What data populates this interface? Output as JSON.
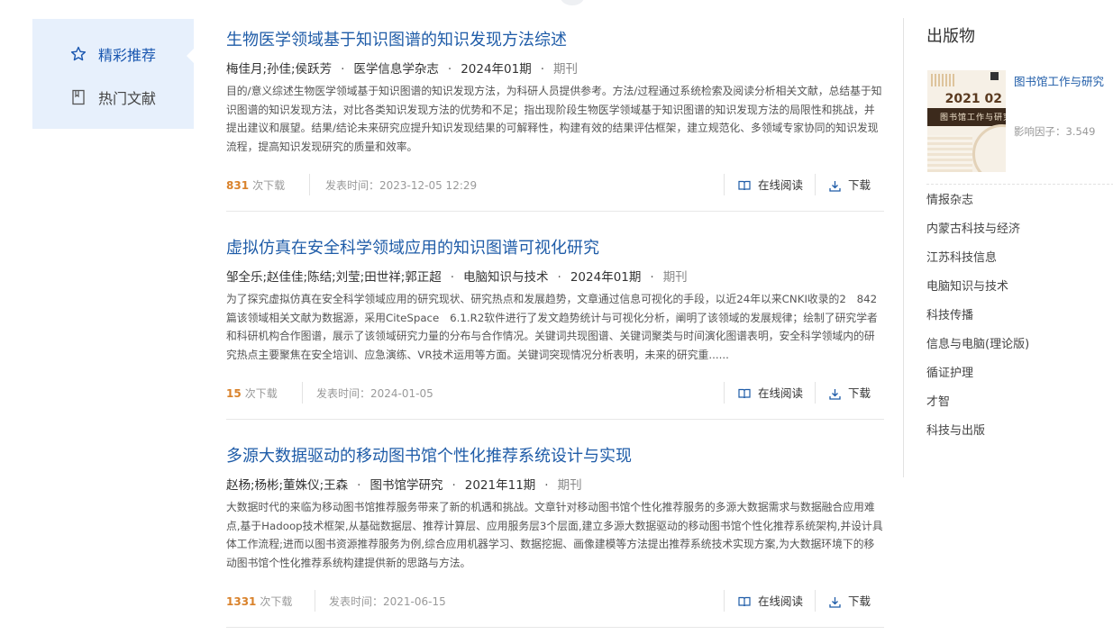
{
  "nav": {
    "items": [
      {
        "label": "精彩推荐",
        "icon": "star-icon",
        "active": true
      },
      {
        "label": "热门文献",
        "icon": "bookmark-icon",
        "active": false
      }
    ]
  },
  "articles": [
    {
      "title": "生物医学领域基于知识图谱的知识发现方法综述",
      "authors": "梅佳月;孙佳;侯跃芳",
      "journal": "医学信息学杂志",
      "issue": "2024年01期",
      "type": "期刊",
      "abstract": "目的/意义综述生物医学领域基于知识图谱的知识发现方法，为科研人员提供参考。方法/过程通过系统检索及阅读分析相关文献，总结基于知识图谱的知识发现方法，对比各类知识发现方法的优势和不足；指出现阶段生物医学领域基于知识图谱的知识发现方法的局限性和挑战，并提出建议和展望。结果/结论未来研究应提升知识发现结果的可解释性，构建有效的结果评估框架，建立规范化、多领域专家协同的知识发现流程，提高知识发现研究的质量和效率。",
      "downloads": "831",
      "downloads_unit": "次下载",
      "pub_time": "发表时间：2023-12-05 12:29",
      "read_label": "在线阅读",
      "download_label": "下载"
    },
    {
      "title": "虚拟仿真在安全科学领域应用的知识图谱可视化研究",
      "authors": "邹全乐;赵佳佳;陈结;刘莹;田世祥;郭正超",
      "journal": "电脑知识与技术",
      "issue": "2024年01期",
      "type": "期刊",
      "abstract": "为了探究虚拟仿真在安全科学领域应用的研究现状、研究热点和发展趋势，文章通过信息可视化的手段，以近24年以来CNKI收录的2　842篇该领域相关文献为数据源，采用CiteSpace　6.1.R2软件进行了发文趋势统计与可视化分析，阐明了该领域的发展规律；绘制了研究学者和科研机构合作图谱，展示了该领域研究力量的分布与合作情况。关键词共现图谱、关键词聚类与时间演化图谱表明，安全科学领域内的研究热点主要聚焦在安全培训、应急演练、VR技术运用等方面。关键词突现情况分析表明，未来的研究重......",
      "downloads": "15",
      "downloads_unit": "次下载",
      "pub_time": "发表时间：2024-01-05",
      "read_label": "在线阅读",
      "download_label": "下载"
    },
    {
      "title": "多源大数据驱动的移动图书馆个性化推荐系统设计与实现",
      "authors": "赵杨;杨彬;董姝仪;王森",
      "journal": "图书馆学研究",
      "issue": "2021年11期",
      "type": "期刊",
      "abstract": "大数据时代的来临为移动图书馆推荐服务带来了新的机遇和挑战。文章针对移动图书馆个性化推荐服务的多源大数据需求与数据融合应用难点,基于Hadoop技术框架,从基础数据层、推荐计算层、应用服务层3个层面,建立多源大数据驱动的移动图书馆个性化推荐系统架构,并设计具体工作流程;进而以图书资源推荐服务为例,综合应用机器学习、数据挖掘、画像建模等方法提出推荐系统技术实现方案,为大数据环境下的移动图书馆个性化推荐系统构建提供新的思路与方法。",
      "downloads": "1331",
      "downloads_unit": "次下载",
      "pub_time": "发表时间：2021-06-15",
      "read_label": "在线阅读",
      "download_label": "下载"
    }
  ],
  "sidebar": {
    "heading": "出版物",
    "featured": {
      "name": "图书馆工作与研究",
      "impact": "影响因子：3.549",
      "cover_issue": "2021 02",
      "cover_title": "图书馆工作与研究"
    },
    "list": [
      "情报杂志",
      "内蒙古科技与经济",
      "江苏科技信息",
      "电脑知识与技术",
      "科技传播",
      "信息与电脑(理论版)",
      "循证护理",
      "才智",
      "科技与出版"
    ]
  },
  "colors": {
    "accent": "#1f5ca8",
    "nav_bg": "#e7f0fc",
    "download_count": "#d9822b"
  }
}
